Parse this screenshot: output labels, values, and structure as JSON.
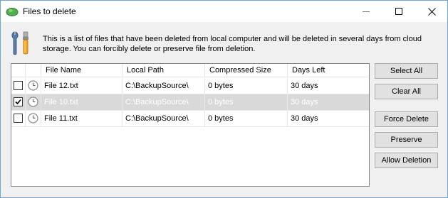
{
  "window": {
    "title": "Files to delete"
  },
  "info": {
    "text": "This is a list of files that have been deleted from local computer and will be deleted in several days from cloud storage. You can forcibly delete or preserve file from deletion."
  },
  "table": {
    "columns": [
      "File Name",
      "Local Path",
      "Compressed Size",
      "Days Left"
    ],
    "rows": [
      {
        "checked": false,
        "selected": false,
        "name": "File 12.txt",
        "path": "C:\\BackupSource\\",
        "size": "0 bytes",
        "days": "30 days"
      },
      {
        "checked": true,
        "selected": true,
        "name": "File 10.txt",
        "path": "C:\\BackupSource\\",
        "size": "0 bytes",
        "days": "30 days"
      },
      {
        "checked": false,
        "selected": false,
        "name": "File 11.txt",
        "path": "C:\\BackupSource\\",
        "size": "0 bytes",
        "days": "30 days"
      }
    ]
  },
  "buttons": {
    "select_all": "Select All",
    "clear_all": "Clear All",
    "force_delete": "Force Delete",
    "preserve": "Preserve",
    "allow_deletion": "Allow Deletion"
  },
  "colors": {
    "window_border": "#6fa8d8",
    "selected_row": "#d9d9d9",
    "dialog_bg": "#f0f0f0"
  }
}
